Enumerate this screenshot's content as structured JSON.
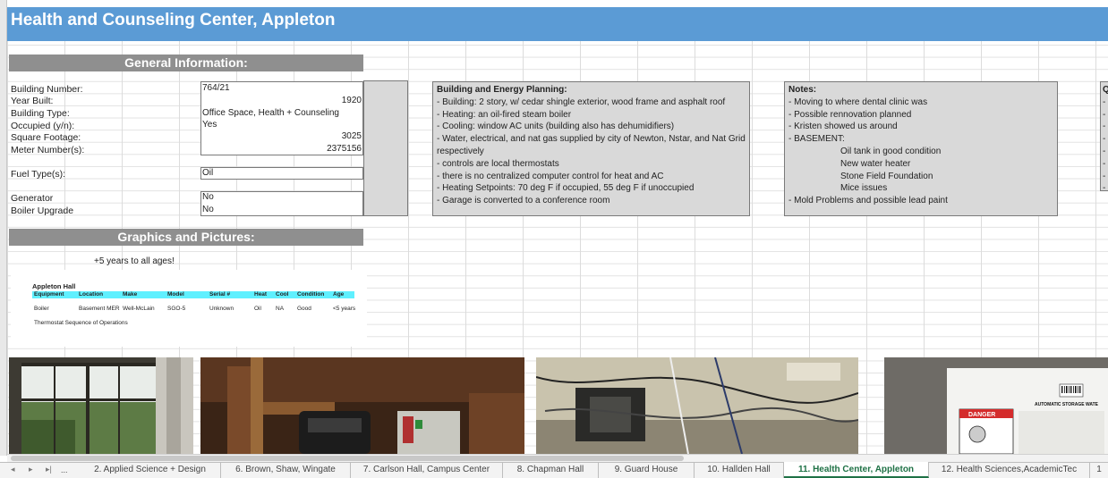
{
  "title": "Health and Counseling Center, Appleton",
  "general": {
    "header": "General Information:",
    "labels": [
      "Building Number:",
      "Year Built:",
      "Building Type:",
      "Occupied (y/n):",
      "Square Footage:",
      "Meter Number(s):",
      "Fuel Type(s):",
      "Generator",
      "Boiler Upgrade"
    ],
    "values": {
      "building_number": "764/21",
      "year_built": "1920",
      "building_type": "Office Space, Health + Counseling",
      "occupied": "Yes",
      "square_footage": "3025",
      "meter_number": "2375156",
      "fuel_type": "Oil",
      "generator": "No",
      "boiler_upgrade": "No"
    }
  },
  "planning": {
    "header": "Building and Energy Planning:",
    "lines": [
      "- Building: 2 story, w/ cedar shingle exterior, wood frame and asphalt roof",
      "- Heating: an oil-fired steam boiler",
      "- Cooling: window AC units (building also has dehumidifiers)",
      "- Water, electrical, and nat gas supplied by city of Newton, Nstar, and Nat Grid respectively",
      "- controls are local thermostats",
      "- there is no centralized computer control for heat and AC",
      "- Heating Setpoints: 70 deg F if occupied, 55 deg F if unoccupied",
      "- Garage is converted to a conference room"
    ]
  },
  "notes": {
    "header": "Notes:",
    "lines": [
      "- Moving to where dental clinic was",
      "- Possible rennovation planned",
      "- Kristen showed us around",
      "- BASEMENT:"
    ],
    "basement": [
      "Oil tank in good condition",
      "New water heater",
      "Stone Field Foundation",
      "Mice issues"
    ],
    "last": "- Mold Problems and possible lead paint"
  },
  "partial_box": {
    "header": "Q",
    "dashes": [
      "-",
      "-",
      "-",
      "-",
      "-",
      "-",
      "-",
      "-"
    ]
  },
  "graphics": {
    "header": "Graphics and Pictures:",
    "note": "+5 years to all ages!",
    "table": {
      "title": "Appleton Hall",
      "headers": [
        "Equipment",
        "Location",
        "Make",
        "Model",
        "Serial #",
        "Heat",
        "Cool",
        "Condition",
        "Age"
      ],
      "row": [
        "Boiler",
        "Basement MER",
        "Well-McLain",
        "SGO-5",
        "Unknown",
        "Oil",
        "NA",
        "Good",
        "<5 years"
      ],
      "footer": "Thermostat  Sequence of Operations"
    }
  },
  "photos": {
    "sticker": "AUTOMATIC STORAGE WATE",
    "danger": "DANGER"
  },
  "tabs": {
    "more": "...",
    "items": [
      "2. Applied Science + Design",
      "6. Brown, Shaw, Wingate",
      "7. Carlson Hall, Campus Center",
      "8. Chapman Hall",
      "9. Guard House",
      "10. Hallden Hall",
      "11. Health Center, Appleton",
      "12. Health Sciences,AcademicTec",
      "1"
    ],
    "active_index": 6
  },
  "colors": {
    "title_bar": "#5b9bd5",
    "section_header": "#8f8f8f",
    "box_fill": "#d9d9d9",
    "table_header": "#5ff0ff",
    "active_tab": "#1e7145"
  }
}
